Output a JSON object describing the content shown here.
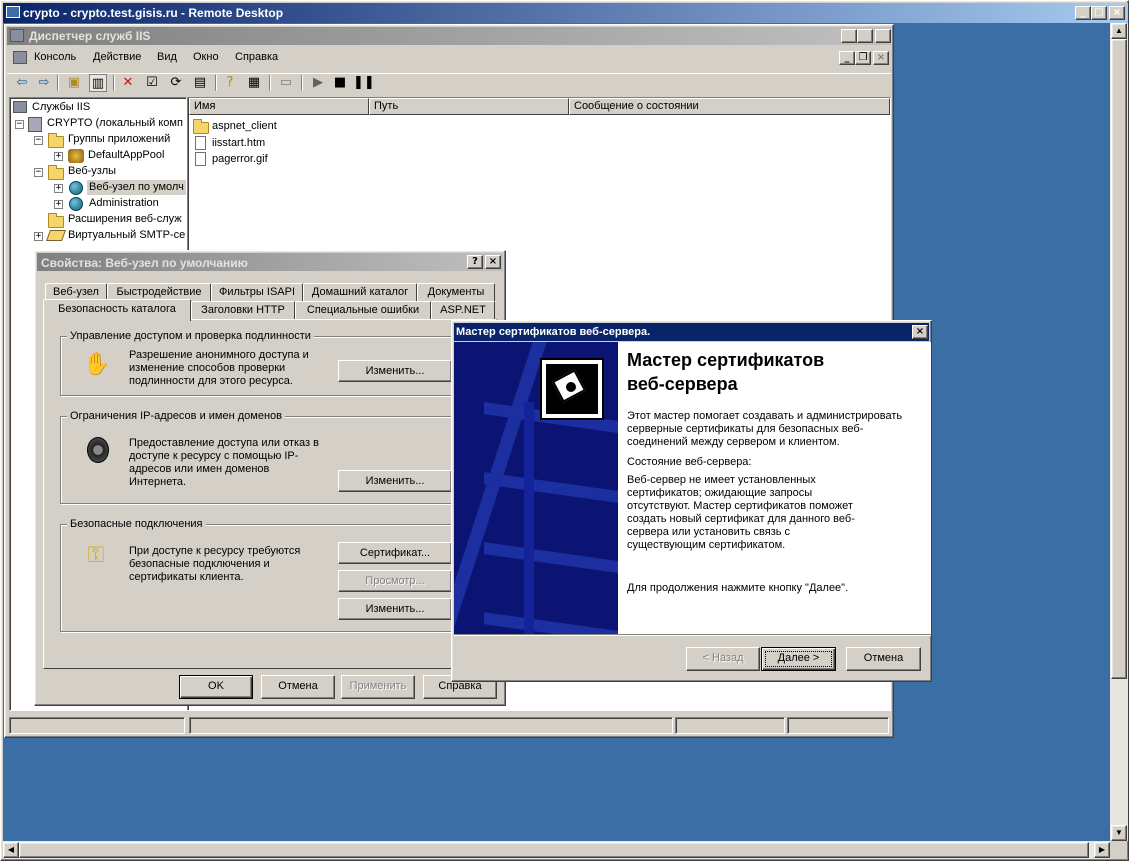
{
  "rdp": {
    "title": "crypto - crypto.test.gisis.ru - Remote Desktop"
  },
  "iis": {
    "title": "Диспетчер служб IIS",
    "menu": [
      "Консоль",
      "Действие",
      "Вид",
      "Окно",
      "Справка"
    ],
    "tree": [
      {
        "label": "Службы IIS"
      },
      {
        "label": "CRYPTO (локальный комп"
      },
      {
        "label": "Группы приложений"
      },
      {
        "label": "DefaultAppPool"
      },
      {
        "label": "Веб-узлы"
      },
      {
        "label": "Веб-узел по умолч"
      },
      {
        "label": "Administration"
      },
      {
        "label": "Расширения веб-служ"
      },
      {
        "label": "Виртуальный SMTP-се"
      }
    ],
    "list_headers": [
      "Имя",
      "Путь",
      "Сообщение о состоянии"
    ],
    "list_items": [
      "aspnet_client",
      "iisstart.htm",
      "pagerror.gif"
    ]
  },
  "props": {
    "title": "Свойства: Веб-узел по умолчанию",
    "tabs_row1": [
      "Веб-узел",
      "Быстродействие",
      "Фильтры ISAPI",
      "Домашний каталог",
      "Документы"
    ],
    "tabs_row2": [
      "Безопасность каталога",
      "Заголовки HTTP",
      "Специальные ошибки",
      "ASP.NET"
    ],
    "group1": {
      "label": "Управление доступом и проверка подлинности",
      "text": "Разрешение анонимного доступа и изменение способов проверки подлинности для этого ресурса.",
      "button": "Изменить..."
    },
    "group2": {
      "label": "Ограничения IP-адресов и имен доменов",
      "text": "Предоставление доступа или отказ в доступе к ресурсу с помощью IP-адресов или имен доменов Интернета.",
      "button": "Изменить..."
    },
    "group3": {
      "label": "Безопасные подключения",
      "text": "При доступе к ресурсу требуются безопасные подключения и сертификаты клиента.",
      "btn_cert": "Сертификат...",
      "btn_view": "Просмотр...",
      "btn_edit": "Изменить..."
    },
    "ok": "OK",
    "cancel": "Отмена",
    "apply": "Применить",
    "help": "Справка"
  },
  "wizard": {
    "title": "Мастер сертификатов веб-сервера.",
    "heading1": "Мастер сертификатов",
    "heading2": "веб-сервера",
    "para1": "Этот мастер помогает создавать и администрировать серверные сертификаты для безопасных веб-соединений между сервером и клиентом.",
    "status_label": "Состояние веб-сервера:",
    "para2": "Веб-сервер не имеет установленных сертификатов; ожидающие запросы отсутствуют. Мастер сертификатов поможет создать новый сертификат для данного веб-сервера или установить связь с существующим сертификатом.",
    "para3": "Для продолжения нажмите кнопку \"Далее\".",
    "back": "< Назад",
    "next": "Далее >",
    "cancel": "Отмена"
  },
  "colors": {
    "desktop": "#3a6ea5",
    "wizard_side": "#0c1473",
    "titlebar_active": "#0a246a"
  }
}
